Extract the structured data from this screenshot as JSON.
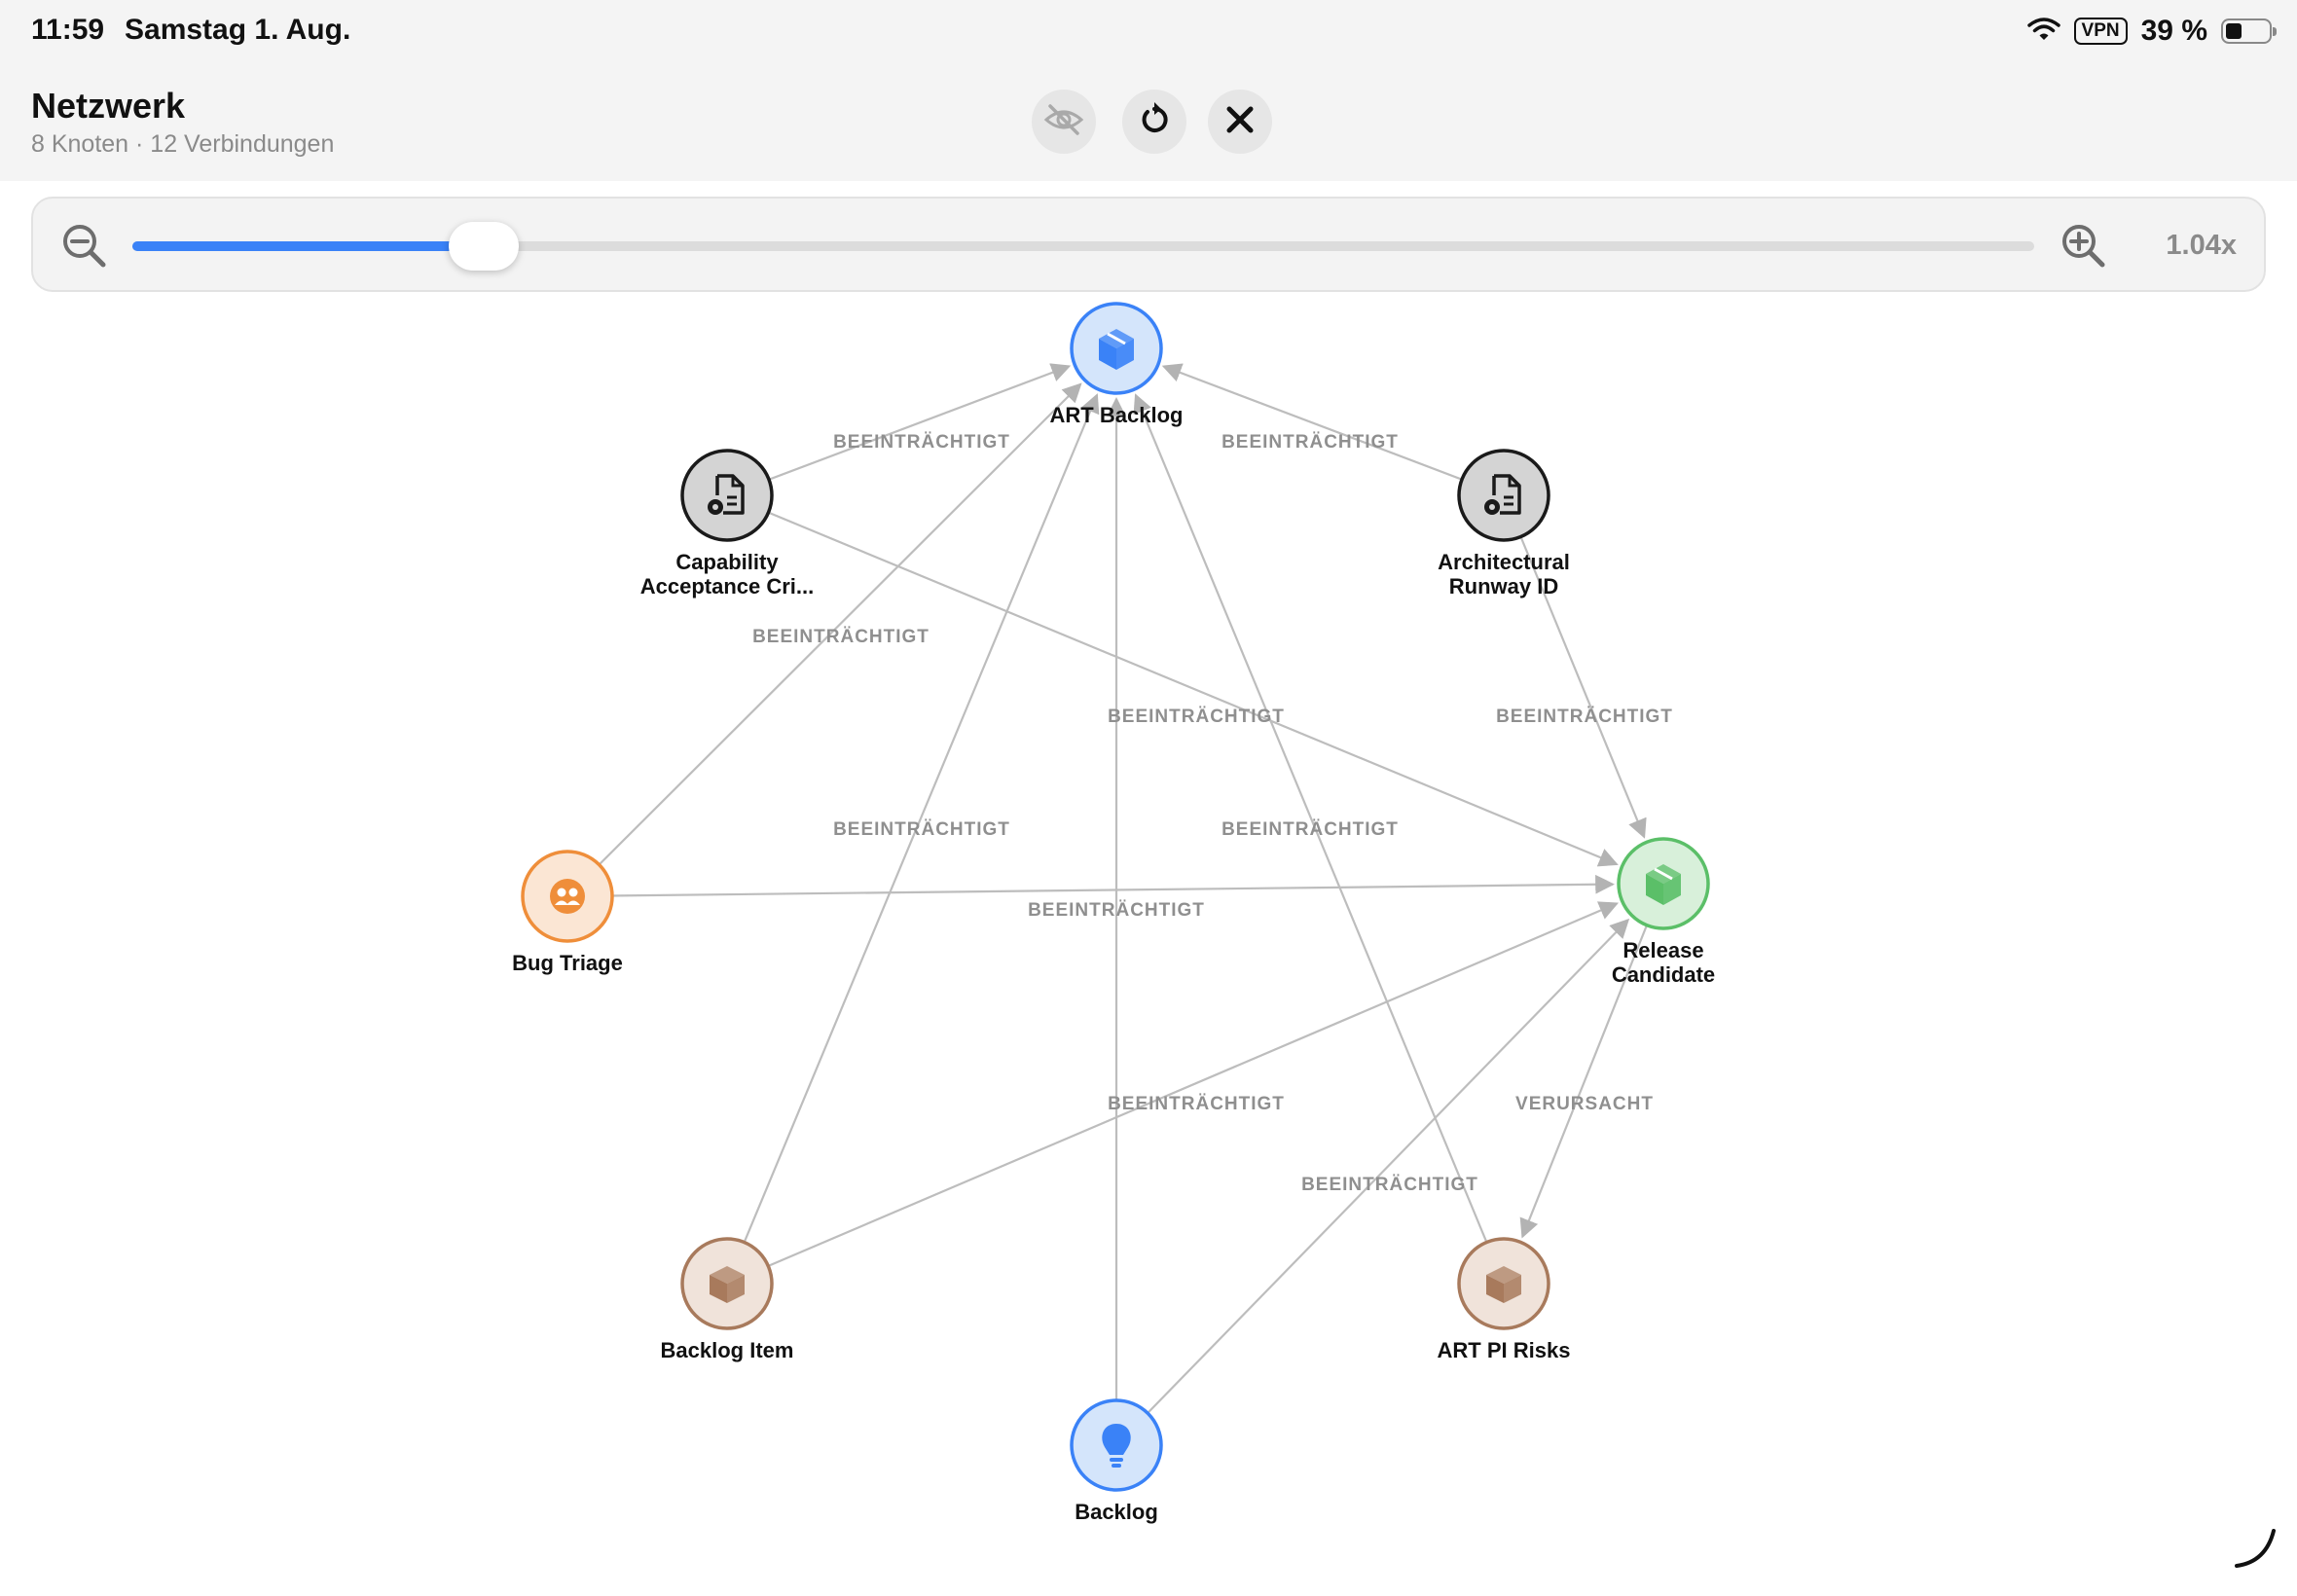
{
  "status_bar": {
    "time": "11:59",
    "date": "Samstag 1. Aug.",
    "vpn": "VPN",
    "battery_text": "39 %",
    "icons": [
      "wifi-icon",
      "battery-icon"
    ]
  },
  "header": {
    "title": "Netzwerk",
    "subtitle": "8 Knoten · 12 Verbindungen",
    "buttons": [
      {
        "name": "hide-button",
        "icon": "eye-slash-icon"
      },
      {
        "name": "reset-button",
        "icon": "rotate-ccw-icon"
      },
      {
        "name": "close-button",
        "icon": "close-icon"
      }
    ]
  },
  "zoom": {
    "value_label": "1.04x",
    "slider_fraction": 0.185,
    "accent_color": "#3a82f7"
  },
  "graph": {
    "nodes": [
      {
        "id": "art_backlog",
        "label": [
          "ART Backlog"
        ],
        "icon": "cube-icon",
        "color": "#3a82f7",
        "fill": "#d4e5fb"
      },
      {
        "id": "capability",
        "label": [
          "Capability",
          "Acceptance Cri..."
        ],
        "icon": "document-gear-icon",
        "color": "#1a1a1a",
        "fill": "#d4d4d4"
      },
      {
        "id": "arch_runway",
        "label": [
          "Architectural",
          "Runway ID"
        ],
        "icon": "document-gear-icon",
        "color": "#1a1a1a",
        "fill": "#d4d4d4"
      },
      {
        "id": "bug_triage",
        "label": [
          "Bug Triage"
        ],
        "icon": "people-icon",
        "color": "#ef8e3a",
        "fill": "#fbe6d4"
      },
      {
        "id": "release_candidate",
        "label": [
          "Release",
          "Candidate"
        ],
        "icon": "cube-icon",
        "color": "#5bbf68",
        "fill": "#d8f0da"
      },
      {
        "id": "backlog_item",
        "label": [
          "Backlog Item"
        ],
        "icon": "box-icon",
        "color": "#a87a5c",
        "fill": "#f0e3da"
      },
      {
        "id": "art_pi_risks",
        "label": [
          "ART PI Risks"
        ],
        "icon": "box-icon",
        "color": "#a87a5c",
        "fill": "#f0e3da"
      },
      {
        "id": "backlog",
        "label": [
          "Backlog"
        ],
        "icon": "lightbulb-icon",
        "color": "#3a82f7",
        "fill": "#d4e5fb"
      }
    ],
    "edges": [
      {
        "from": "capability",
        "to": "art_backlog",
        "label": "BEEINTRÄCHTIGT"
      },
      {
        "from": "arch_runway",
        "to": "art_backlog",
        "label": "BEEINTRÄCHTIGT"
      },
      {
        "from": "bug_triage",
        "to": "art_backlog",
        "label": "BEEINTRÄCHTIGT"
      },
      {
        "from": "capability",
        "to": "release_candidate",
        "label": "BEEINTRÄCHTIGT"
      },
      {
        "from": "arch_runway",
        "to": "release_candidate",
        "label": "BEEINTRÄCHTIGT"
      },
      {
        "from": "backlog_item",
        "to": "art_backlog",
        "label": "BEEINTRÄCHTIGT"
      },
      {
        "from": "art_pi_risks",
        "to": "art_backlog",
        "label": "BEEINTRÄCHTIGT"
      },
      {
        "from": "bug_triage",
        "to": "release_candidate",
        "label": "BEEINTRÄCHTIGT"
      },
      {
        "from": "backlog_item",
        "to": "release_candidate",
        "label": "BEEINTRÄCHTIGT"
      },
      {
        "from": "release_candidate",
        "to": "art_pi_risks",
        "label": "VERURSACHT"
      },
      {
        "from": "backlog",
        "to": "release_candidate",
        "label": "BEEINTRÄCHTIGT"
      },
      {
        "from": "backlog",
        "to": "art_backlog",
        "label": ""
      }
    ]
  }
}
